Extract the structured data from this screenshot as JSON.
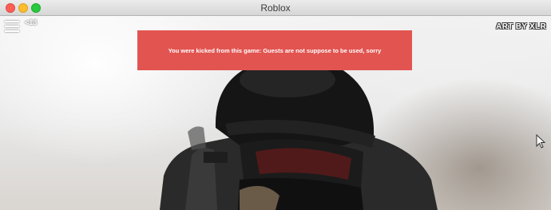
{
  "window": {
    "title": "Roblox",
    "controls": [
      "close",
      "minimize",
      "zoom"
    ]
  },
  "hud": {
    "menu_icon": "hamburger-menu-icon",
    "age_badge": "<13",
    "art_credit": "ART BY XLR"
  },
  "dialog": {
    "message": "You were kicked from this game: Guests are not suppose to be used, sorry",
    "background": "#e25450"
  },
  "cursor": {
    "icon": "mouse-pointer-icon"
  }
}
